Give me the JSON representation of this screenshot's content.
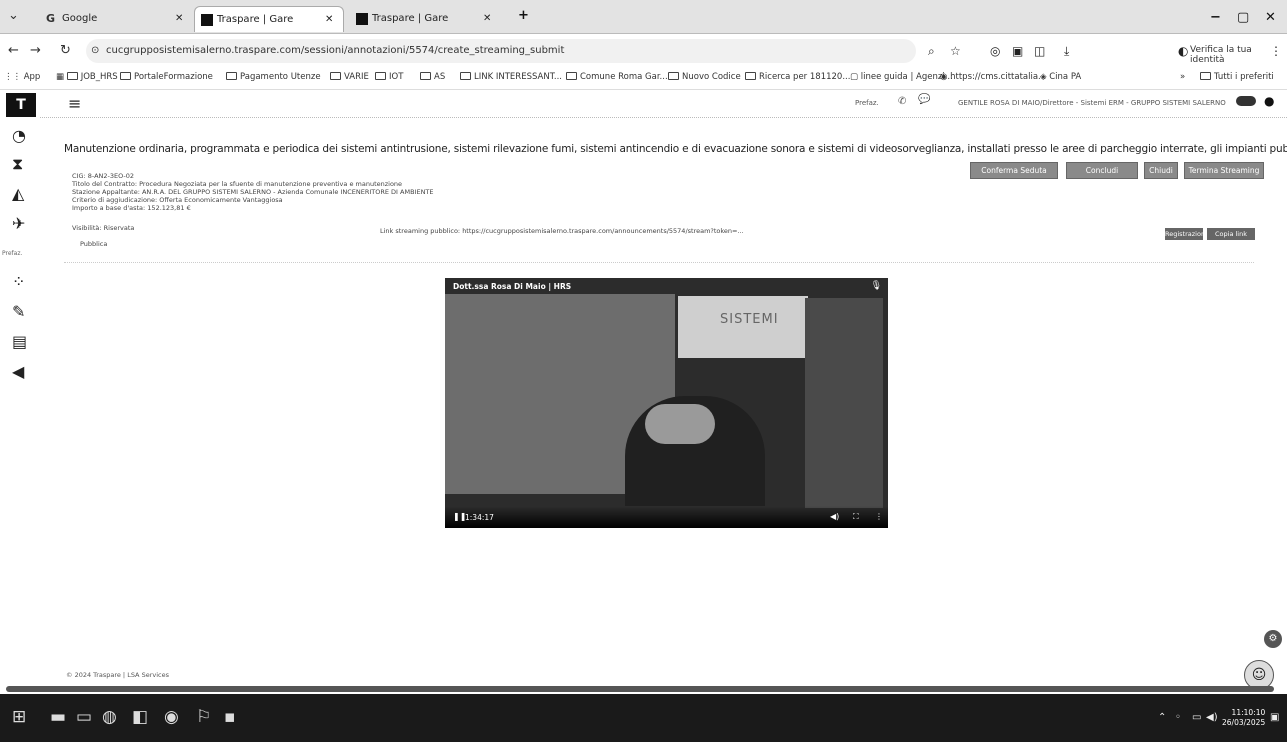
{
  "tabs": [
    {
      "label": "Google"
    },
    {
      "label": "Traspare | Gare"
    },
    {
      "label": "Traspare | Gare"
    }
  ],
  "address_bar": {
    "url": "cucgrupposistemisalerno.traspare.com/sessioni/annotazioni/5574/create_streaming_submit",
    "verify_label": "Verifica la tua identità"
  },
  "bookmarks": [
    "App",
    "JOB_HRS",
    "PortaleFormazione",
    "Pagamento Utenze",
    "VARIE",
    "IOT",
    "AS",
    "LINK INTERESSANT...",
    "Comune Roma Gar...",
    "Nuovo Codice",
    "Ricerca per 181120...",
    "linee guida | Agenzi...",
    "https://cms.cittatalia...",
    "Cina PA",
    "Tutti i preferiti"
  ],
  "sidebar": {
    "logo": "T",
    "section_label": "Prefaz."
  },
  "header": {
    "menu_icon": "hamburger-icon",
    "left_text": "Prefaz.",
    "right_text": "GENTILE ROSA DI MAIO/Direttore - Sistemi ERM - GRUPPO SISTEMI SALERNO ..."
  },
  "main": {
    "title": "Manutenzione ordinaria, programmata e periodica dei sistemi antintrusione, sistemi rilevazione fumi, sistemi antincendio e di evacuazione sonora e sistemi di videosorveglianza, installati presso le aree di parcheggio interrate, gli impianti pubblici d",
    "buttons": [
      "Conferma Seduta",
      "Concludi",
      "Chiudi",
      "Termina Streaming"
    ],
    "meta_lines": [
      "CIG: 8-AN2-3EO-02",
      "Titolo del Contratto: Procedura Negoziata per la sfuente di manutenzione preventiva e manutenzione",
      "Stazione Appaltante: AN.R.A. DEL GRUPPO SISTEMI SALERNO - Azienda Comunale INCENERITORE DI AMBIENTE",
      "Criterio di aggiudicazione: Offerta Economicamente Vantaggiosa",
      "Importo a base d'asta: 152.123,81 €",
      "Visibilità: Riservata",
      "Pubblica"
    ],
    "link_text": "Link streaming pubblico: https://cucgrupposistemisalerno.traspare.com/announcements/5574/stream?token=...",
    "small_buttons": [
      "Registrazione",
      "Copia link"
    ]
  },
  "video": {
    "participant": "Dott.ssa Rosa Di Maio | HRS",
    "banner_text": "SISTEMI",
    "time": "1:34:17"
  },
  "footer": {
    "text": "© 2024 Traspare | LSA Services"
  },
  "taskbar": {
    "time": "11:10:10",
    "date": "26/03/2025"
  }
}
